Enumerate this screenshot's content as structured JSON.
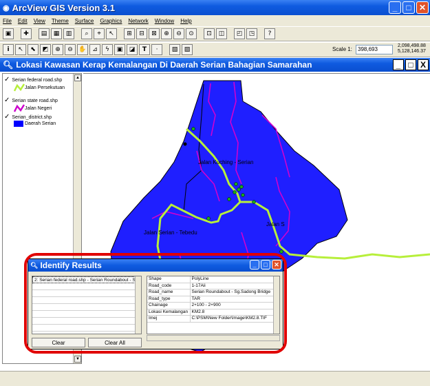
{
  "app": {
    "title": "ArcView GIS Version 3.1",
    "window_buttons": [
      "_",
      "□",
      "✕"
    ]
  },
  "menu": [
    "File",
    "Edit",
    "View",
    "Theme",
    "Surface",
    "Graphics",
    "Network",
    "Window",
    "Help"
  ],
  "toolbar": {
    "scale_label": "Scale 1:",
    "scale_value": "398,693",
    "coord_x": "2,098,498.88",
    "coord_y": "5,128,146.37"
  },
  "view": {
    "title": "Lokasi Kawasan Kerap Kemalangan Di Daerah Serian Bahagian Samarahan"
  },
  "toc": {
    "themes": [
      {
        "name": "Serian federal road.shp",
        "legend": "Jalan Persekutuan",
        "color": "#b7ef3b"
      },
      {
        "name": "Serian state road.shp",
        "legend": "Jalan Negeri",
        "color": "#cc00cc"
      },
      {
        "name": "Serian_district.shp",
        "legend": "Daerah Serian",
        "color": "#0000ff"
      }
    ]
  },
  "map": {
    "labels": [
      "Jalan Kuching - Serian",
      "Jalan Serian - Tebedu",
      "Jalan S"
    ],
    "district_color": "#1f1fff",
    "federal_color": "#b7ef3b",
    "state_color": "#d000d0"
  },
  "identify": {
    "title": "Identify Results",
    "list": [
      "2: Serian federal road.shp - Serian Roundabout - S"
    ],
    "attributes": [
      {
        "field": "Shape",
        "value": "PolyLine"
      },
      {
        "field": "Road_code",
        "value": "1-17Aii"
      },
      {
        "field": "Road_name",
        "value": "Serian Roundabout - Sg.Sadong Bridge"
      },
      {
        "field": "Road_type",
        "value": "TAR"
      },
      {
        "field": "Chainage",
        "value": "2+100 - 2+900"
      },
      {
        "field": "Lokasi Kemalangan",
        "value": "KM2.8"
      },
      {
        "field": "Imej",
        "value": "C:\\PSM\\New Folder\\Image\\KM2.8.TIF"
      }
    ],
    "clear_label": "Clear",
    "clear_all_label": "Clear All"
  }
}
